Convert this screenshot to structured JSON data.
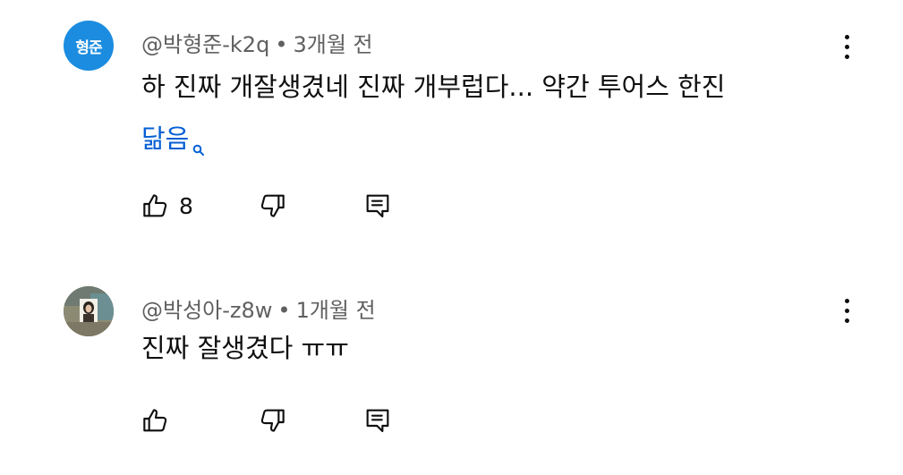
{
  "comments": [
    {
      "avatar_initials": "형준",
      "author": "@박형준-k2q",
      "separator": "•",
      "time": "3개월 전",
      "text": "하 진짜 개잘생겼네 진짜 개부럽다... 약간 투어스 한진",
      "search_link": "닮음",
      "like_count": "8"
    },
    {
      "author": "@박성아-z8w",
      "separator": "•",
      "time": "1개월 전",
      "text": "진짜 잘생겼다 ㅠㅠ",
      "like_count": ""
    }
  ],
  "colors": {
    "author_gray": "#606060",
    "link_blue": "#065fd4",
    "avatar_blue": "#1b8ce0"
  }
}
